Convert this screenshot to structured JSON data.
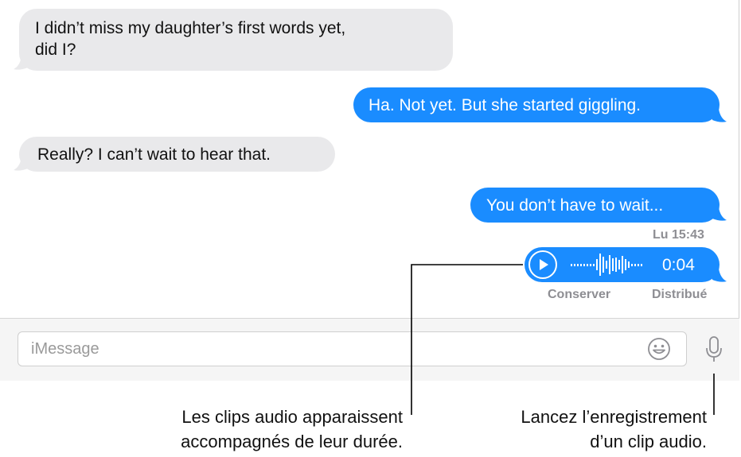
{
  "messages": [
    {
      "direction": "incoming",
      "lines": [
        "I didn’t miss my daughter’s first words yet,",
        "did I?"
      ]
    },
    {
      "direction": "outgoing",
      "text": "Ha. Not yet. But she started giggling."
    },
    {
      "direction": "incoming",
      "text": "Really? I can’t wait to hear that."
    },
    {
      "direction": "outgoing",
      "text": "You don’t have to wait..."
    }
  ],
  "timestamp": "Lu 15:43",
  "audio_clip": {
    "duration": "0:04",
    "keep_label": "Conserver",
    "status": "Distribué"
  },
  "composer": {
    "placeholder": "iMessage"
  },
  "icons": {
    "play": "play-icon",
    "emoji": "emoji-icon",
    "microphone": "microphone-icon"
  },
  "callouts": {
    "left": [
      "Les clips audio apparaissent",
      "accompagnés de leur durée."
    ],
    "right": [
      "Lancez l’enregistrement",
      "d’un clip audio."
    ]
  },
  "colors": {
    "outgoing_bubble": "#1a8cff",
    "incoming_bubble": "#e9e9eb"
  }
}
